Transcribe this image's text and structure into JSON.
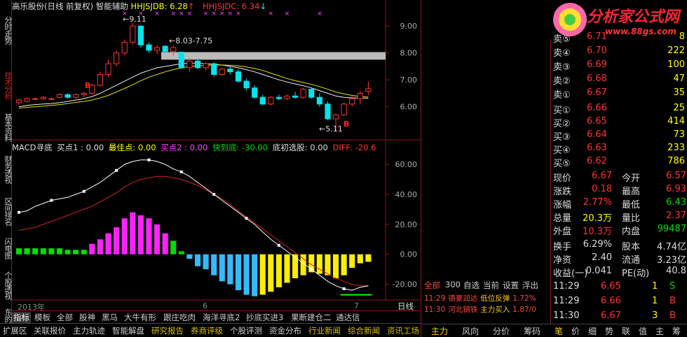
{
  "left_nav": [
    "分时走势",
    "技术分析",
    "基本资料",
    "财务透视",
    "区间排名",
    "闪电图",
    "个股透视",
    "东的"
  ],
  "main_title": {
    "stock": "高乐股份(日线 前复权)",
    "indicator": "智能辅助",
    "hhjsjdb_label": "HHJSJDB: 6.28",
    "hhjsjdc_label": "HHJSJDC: 6.34"
  },
  "price_annotations": {
    "high_label": "9.11",
    "gap_label": "8.03-7.75",
    "low_label": "5.11",
    "buy_marker": "B"
  },
  "price_axis": [
    "9.00",
    "8.00",
    "7.00",
    "6.00"
  ],
  "macd_title": {
    "name": "MACD寻底",
    "buy1": "买点1 : 0.00",
    "best": "最佳点: 0.00",
    "buy2": "买点2 : 0.00",
    "fast": "快到底: -30.00",
    "bottom": "底初选股: 0.00",
    "diff": "DIFF: -20.6"
  },
  "macd_axis": [
    "60.00",
    "40.00",
    "20.00",
    "0.00",
    "-20.00"
  ],
  "date_axis": {
    "year": "2013年",
    "m6": "6",
    "m7": "7",
    "period": "日线"
  },
  "tabs_row1": [
    "指标",
    "模板",
    "全部",
    "股神",
    "黑马",
    "大牛有形",
    "跟庄吃肉",
    "海洋寻底2",
    "抄底买进3",
    "果断建仓二",
    "通达信"
  ],
  "tabs_row2": [
    "扩展区",
    "关联报价",
    "主力轨迹",
    "智能解盘",
    "研究报告",
    "券商评级",
    "个股评测",
    "资金分布",
    "行业新闻",
    "综合新闻",
    "资讯工场"
  ],
  "brand": {
    "name": "分析家公式网",
    "url": "www.88gs.com"
  },
  "order_book": {
    "asks": [
      {
        "label": "卖⑤",
        "price": "6.71",
        "vol": "8"
      },
      {
        "label": "卖④",
        "price": "6.70",
        "vol": "222"
      },
      {
        "label": "卖③",
        "price": "6.69",
        "vol": "100"
      },
      {
        "label": "卖②",
        "price": "6.68",
        "vol": "47"
      },
      {
        "label": "卖①",
        "price": "6.67",
        "vol": "35"
      }
    ],
    "bids": [
      {
        "label": "买①",
        "price": "6.66",
        "vol": "25"
      },
      {
        "label": "买②",
        "price": "6.65",
        "vol": "414"
      },
      {
        "label": "买③",
        "price": "6.64",
        "vol": "73"
      },
      {
        "label": "买④",
        "price": "6.63",
        "vol": "233"
      },
      {
        "label": "买⑤",
        "price": "6.62",
        "vol": "786"
      }
    ]
  },
  "stats": [
    {
      "l1": "现价",
      "v1": "6.67",
      "c1": "red",
      "l2": "今开",
      "v2": "6.57",
      "c2": "red"
    },
    {
      "l1": "涨跌",
      "v1": "0.18",
      "c1": "red",
      "l2": "最高",
      "v2": "6.93",
      "c2": "red"
    },
    {
      "l1": "涨幅",
      "v1": "2.77%",
      "c1": "red",
      "l2": "最低",
      "v2": "6.43",
      "c2": "green"
    },
    {
      "l1": "总量",
      "v1": "20.3万",
      "c1": "yellow",
      "l2": "量比",
      "v2": "2.37",
      "c2": "red"
    },
    {
      "l1": "外盘",
      "v1": "10.3万",
      "c1": "red",
      "l2": "内盘",
      "v2": "99487",
      "c2": "green"
    }
  ],
  "stats2": [
    {
      "l1": "换手",
      "v1": "6.29%",
      "l2": "股本",
      "v2": "4.74亿"
    },
    {
      "l1": "净资",
      "v1": "2.40",
      "l2": "流通",
      "v2": "3.23亿"
    },
    {
      "l1": "收益(一)",
      "v1": "0.041",
      "l2": "PE(动)",
      "v2": "40.8"
    }
  ],
  "trade_tabs": [
    "全部",
    "300",
    "自选",
    "当前",
    "设置",
    "浮出"
  ],
  "news": [
    {
      "time": "11:29",
      "name": "德豪润达",
      "event": "低位反弹",
      "val": "1.72%"
    },
    {
      "time": "11:30",
      "name": "河北钢铁",
      "event": "主力买入",
      "val": "1.87/0"
    }
  ],
  "ticks": [
    {
      "time": "11:29",
      "price": "6.65",
      "vol": "1",
      "side": "S"
    },
    {
      "time": "11:29",
      "price": "6.66",
      "vol": "1",
      "side": "B"
    },
    {
      "time": "11:30",
      "price": "6.67",
      "vol": "3",
      "side": "B"
    }
  ],
  "right_bottom_tabs_left": [
    "主力",
    "风向",
    "分价",
    "筹码"
  ],
  "right_bottom_tabs_right": [
    "笔",
    "价",
    "细",
    "势",
    "联",
    "值",
    "主",
    "筹"
  ],
  "chart_data": [
    {
      "type": "candlestick",
      "title": "高乐股份(日线 前复权)",
      "ylim": [
        4.9,
        9.5
      ],
      "candles": [
        {
          "o": 6.15,
          "h": 6.3,
          "l": 6.05,
          "c": 6.25
        },
        {
          "o": 6.2,
          "h": 6.35,
          "l": 6.15,
          "c": 6.3
        },
        {
          "o": 6.3,
          "h": 6.35,
          "l": 6.25,
          "c": 6.3
        },
        {
          "o": 6.3,
          "h": 6.4,
          "l": 6.25,
          "c": 6.35
        },
        {
          "o": 6.3,
          "h": 6.35,
          "l": 6.25,
          "c": 6.3
        },
        {
          "o": 6.35,
          "h": 6.5,
          "l": 6.3,
          "c": 6.45
        },
        {
          "o": 6.45,
          "h": 6.5,
          "l": 6.3,
          "c": 6.35
        },
        {
          "o": 6.35,
          "h": 6.5,
          "l": 6.3,
          "c": 6.45
        },
        {
          "o": 6.45,
          "h": 6.55,
          "l": 6.35,
          "c": 6.5
        },
        {
          "o": 6.5,
          "h": 6.85,
          "l": 6.45,
          "c": 6.8
        },
        {
          "o": 6.8,
          "h": 7.3,
          "l": 6.75,
          "c": 7.2
        },
        {
          "o": 7.2,
          "h": 7.75,
          "l": 7.1,
          "c": 7.6
        },
        {
          "o": 7.6,
          "h": 8.1,
          "l": 7.5,
          "c": 8.0
        },
        {
          "o": 8.0,
          "h": 8.5,
          "l": 7.9,
          "c": 8.4
        },
        {
          "o": 8.4,
          "h": 9.11,
          "l": 8.3,
          "c": 9.0
        },
        {
          "o": 9.0,
          "h": 9.0,
          "l": 8.2,
          "c": 8.3
        },
        {
          "o": 8.3,
          "h": 8.4,
          "l": 8.0,
          "c": 8.1
        },
        {
          "o": 8.1,
          "h": 8.3,
          "l": 7.95,
          "c": 8.2
        },
        {
          "o": 8.25,
          "h": 8.3,
          "l": 8.0,
          "c": 8.05
        },
        {
          "o": 8.05,
          "h": 8.3,
          "l": 7.9,
          "c": 8.2
        },
        {
          "o": 8.03,
          "h": 8.05,
          "l": 7.4,
          "c": 7.45
        },
        {
          "o": 7.45,
          "h": 7.8,
          "l": 7.3,
          "c": 7.7
        },
        {
          "o": 7.7,
          "h": 7.8,
          "l": 7.4,
          "c": 7.45
        },
        {
          "o": 7.45,
          "h": 7.65,
          "l": 7.35,
          "c": 7.6
        },
        {
          "o": 7.6,
          "h": 7.65,
          "l": 7.1,
          "c": 7.2
        },
        {
          "o": 7.2,
          "h": 7.45,
          "l": 7.15,
          "c": 7.4
        },
        {
          "o": 7.4,
          "h": 7.5,
          "l": 7.2,
          "c": 7.3
        },
        {
          "o": 7.3,
          "h": 7.4,
          "l": 6.9,
          "c": 6.95
        },
        {
          "o": 6.95,
          "h": 7.05,
          "l": 6.6,
          "c": 6.7
        },
        {
          "o": 6.7,
          "h": 6.8,
          "l": 6.3,
          "c": 6.35
        },
        {
          "o": 6.35,
          "h": 6.45,
          "l": 6.05,
          "c": 6.1
        },
        {
          "o": 6.1,
          "h": 6.4,
          "l": 6.05,
          "c": 6.35
        },
        {
          "o": 6.35,
          "h": 6.45,
          "l": 6.25,
          "c": 6.3
        },
        {
          "o": 6.3,
          "h": 6.45,
          "l": 6.25,
          "c": 6.4
        },
        {
          "o": 6.4,
          "h": 6.55,
          "l": 6.3,
          "c": 6.35
        },
        {
          "o": 6.35,
          "h": 6.7,
          "l": 6.3,
          "c": 6.65
        },
        {
          "o": 6.65,
          "h": 6.7,
          "l": 6.3,
          "c": 6.35
        },
        {
          "o": 6.35,
          "h": 6.5,
          "l": 6.0,
          "c": 6.1
        },
        {
          "o": 6.1,
          "h": 6.2,
          "l": 5.5,
          "c": 5.55
        },
        {
          "o": 5.55,
          "h": 5.75,
          "l": 5.11,
          "c": 5.7
        },
        {
          "o": 5.7,
          "h": 6.15,
          "l": 5.65,
          "c": 6.1
        },
        {
          "o": 6.1,
          "h": 6.4,
          "l": 6.0,
          "c": 6.3
        },
        {
          "o": 6.3,
          "h": 6.6,
          "l": 6.1,
          "c": 6.5
        },
        {
          "o": 6.57,
          "h": 6.93,
          "l": 6.43,
          "c": 6.67
        }
      ],
      "ma_white": [
        6.0,
        6.05,
        6.08,
        6.1,
        6.12,
        6.15,
        6.2,
        6.25,
        6.3,
        6.38,
        6.5,
        6.65,
        6.8,
        6.95,
        7.1,
        7.25,
        7.35,
        7.45,
        7.5,
        7.55,
        7.6,
        7.62,
        7.62,
        7.6,
        7.58,
        7.55,
        7.5,
        7.45,
        7.38,
        7.3,
        7.2,
        7.1,
        7.0,
        6.92,
        6.85,
        6.78,
        6.7,
        6.6,
        6.5,
        6.4,
        6.35,
        6.33,
        6.32,
        6.32
      ],
      "ma_yellow": [
        5.95,
        5.98,
        6.0,
        6.02,
        6.05,
        6.08,
        6.12,
        6.16,
        6.2,
        6.25,
        6.33,
        6.42,
        6.55,
        6.68,
        6.82,
        6.97,
        7.1,
        7.2,
        7.3,
        7.38,
        7.45,
        7.5,
        7.52,
        7.54,
        7.55,
        7.55,
        7.54,
        7.52,
        7.48,
        7.42,
        7.35,
        7.25,
        7.15,
        7.05,
        6.97,
        6.9,
        6.83,
        6.75,
        6.65,
        6.55,
        6.48,
        6.42,
        6.38,
        6.36
      ]
    },
    {
      "type": "bar",
      "title": "MACD寻底",
      "ylim": [
        -30,
        68
      ],
      "macd": [
        4,
        4,
        4,
        4,
        4,
        4,
        3,
        3,
        3,
        7,
        10,
        14,
        18,
        24,
        28,
        26,
        24,
        20,
        14,
        9,
        2,
        -3,
        -8,
        -10,
        -14,
        -18,
        -20,
        -24,
        -27,
        -28,
        -27,
        -25,
        -22,
        -19,
        -16,
        -14,
        -12,
        -13,
        -14,
        -16,
        -14,
        -9,
        -6,
        -5
      ],
      "diff": [
        28,
        29,
        32,
        34,
        36,
        37,
        38,
        40,
        42,
        45,
        48,
        52,
        56,
        60,
        62,
        63,
        63,
        62,
        60,
        57,
        55,
        52,
        48,
        44,
        40,
        36,
        32,
        28,
        24,
        20,
        15,
        10,
        6,
        2,
        -2,
        -6,
        -10,
        -14,
        -18,
        -21,
        -23,
        -24,
        -22,
        -21
      ],
      "dea": [
        16,
        17,
        18,
        20,
        22,
        24,
        26,
        28,
        30,
        32,
        35,
        38,
        41,
        45,
        48,
        50,
        51,
        52,
        52,
        51,
        50,
        48,
        46,
        43,
        40,
        37,
        33,
        29,
        25,
        21,
        17,
        13,
        9,
        5,
        1,
        -3,
        -7,
        -10,
        -13,
        -16,
        -18,
        -20,
        -21,
        -21
      ]
    }
  ]
}
